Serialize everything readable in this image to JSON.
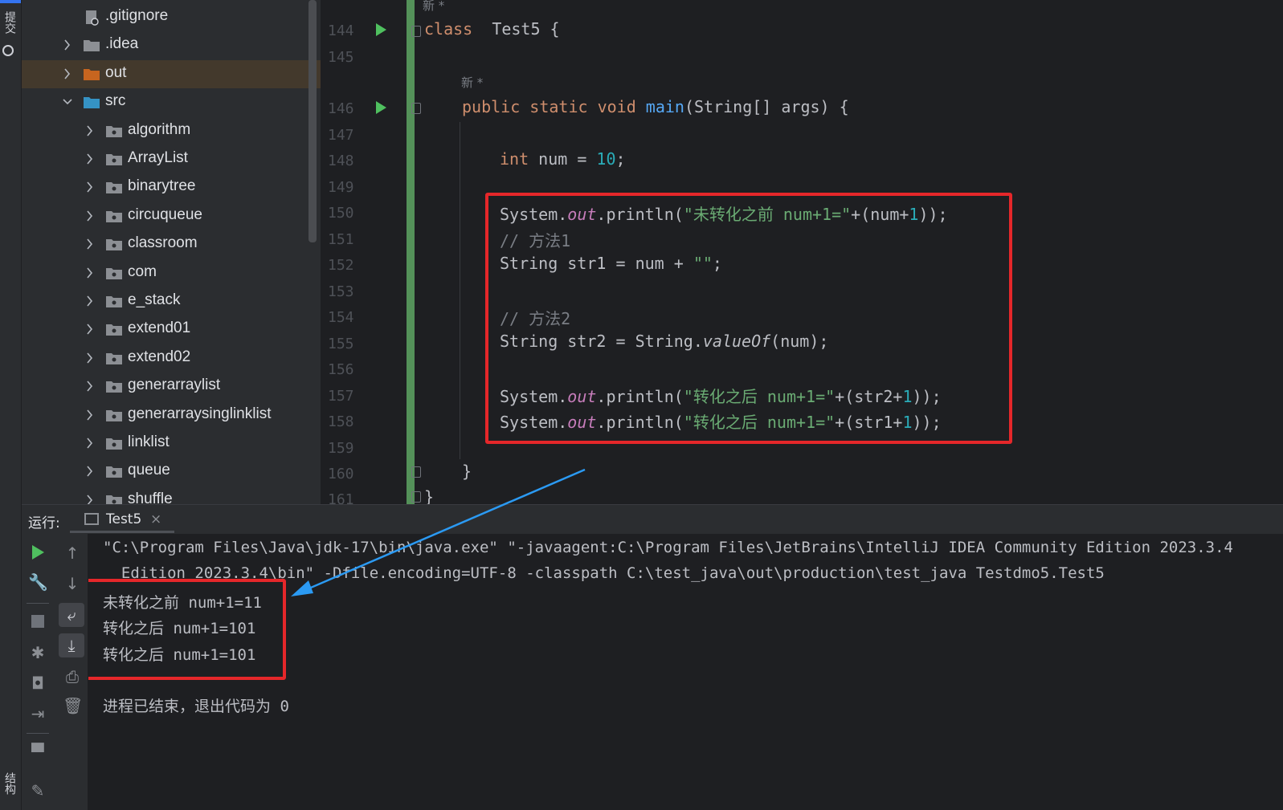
{
  "left_strip": {
    "top_label": "提交",
    "bottom_label": "结构"
  },
  "tree": {
    "items": [
      {
        "label": ".gitignore",
        "kind": "file",
        "depth": 1,
        "expanded": null
      },
      {
        "label": ".idea",
        "kind": "folder",
        "depth": 1,
        "expanded": false
      },
      {
        "label": "out",
        "kind": "folder-orange",
        "depth": 1,
        "expanded": false,
        "selected": true
      },
      {
        "label": "src",
        "kind": "folder-blue",
        "depth": 1,
        "expanded": true
      },
      {
        "label": "algorithm",
        "kind": "package",
        "depth": 2,
        "expanded": false
      },
      {
        "label": "ArrayList",
        "kind": "package",
        "depth": 2,
        "expanded": false
      },
      {
        "label": "binarytree",
        "kind": "package",
        "depth": 2,
        "expanded": false
      },
      {
        "label": "circuqueue",
        "kind": "package",
        "depth": 2,
        "expanded": false
      },
      {
        "label": "classroom",
        "kind": "package",
        "depth": 2,
        "expanded": false
      },
      {
        "label": "com",
        "kind": "package",
        "depth": 2,
        "expanded": false
      },
      {
        "label": "e_stack",
        "kind": "package",
        "depth": 2,
        "expanded": false
      },
      {
        "label": "extend01",
        "kind": "package",
        "depth": 2,
        "expanded": false
      },
      {
        "label": "extend02",
        "kind": "package",
        "depth": 2,
        "expanded": false
      },
      {
        "label": "generarraylist",
        "kind": "package",
        "depth": 2,
        "expanded": false
      },
      {
        "label": "generarraysinglinklist",
        "kind": "package",
        "depth": 2,
        "expanded": false
      },
      {
        "label": "linklist",
        "kind": "package",
        "depth": 2,
        "expanded": false
      },
      {
        "label": "queue",
        "kind": "package",
        "depth": 2,
        "expanded": false
      },
      {
        "label": "shuffle",
        "kind": "package",
        "depth": 2,
        "expanded": false
      }
    ]
  },
  "editor": {
    "hint_new": "新 *",
    "line_numbers": [
      "144",
      "145",
      "146",
      "147",
      "148",
      "149",
      "150",
      "151",
      "152",
      "153",
      "154",
      "155",
      "156",
      "157",
      "158",
      "159",
      "160",
      "161"
    ],
    "lines": {
      "l144": {
        "kw": "class",
        "name": "Test5 {"
      },
      "l146": {
        "kw": "public static void",
        "fn": "main",
        "rest": "(String[] args) {"
      },
      "l148": {
        "kw": "int",
        "mid": " num = ",
        "num": "10",
        "end": ";"
      },
      "l150": {
        "a": "System.",
        "field": "out",
        "b": ".println(",
        "str": "\"未转化之前 num+1=\"",
        "c": "+(num+",
        "num": "1",
        "d": "));"
      },
      "l151": {
        "cmt": "// 方法1"
      },
      "l152": {
        "a": "String str1 = num + ",
        "str": "\"\"",
        "b": ";"
      },
      "l154": {
        "cmt": "// 方法2"
      },
      "l155": {
        "a": "String str2 = String.",
        "ital": "valueOf",
        "b": "(num);"
      },
      "l157": {
        "a": "System.",
        "field": "out",
        "b": ".println(",
        "str": "\"转化之后 num+1=\"",
        "c": "+(str2+",
        "num": "1",
        "d": "));"
      },
      "l158": {
        "a": "System.",
        "field": "out",
        "b": ".println(",
        "str": "\"转化之后 num+1=\"",
        "c": "+(str1+",
        "num": "1",
        "d": "));"
      },
      "l160": {
        "a": "}"
      },
      "l161": {
        "a": "}"
      }
    }
  },
  "run_panel": {
    "label": "运行:",
    "tab": "Test5",
    "tab_close": "×",
    "console": {
      "cmd1": "\"C:\\Program Files\\Java\\jdk-17\\bin\\java.exe\" \"-javaagent:C:\\Program Files\\JetBrains\\IntelliJ IDEA Community Edition 2023.3.4",
      "cmd2": "  Edition 2023.3.4\\bin\" -Dfile.encoding=UTF-8 -classpath C:\\test_java\\out\\production\\test_java Testdmo5.Test5",
      "out1": "未转化之前 num+1=11",
      "out2": "转化之后 num+1=101",
      "out3": "转化之后 num+1=101",
      "exit": "进程已结束，退出代码为 0"
    }
  },
  "colors": {
    "highlight": "#e5272a",
    "arrow": "#2b9af3",
    "run_green": "#4fc05f",
    "change_bar": "#549159"
  },
  "icons": [
    "file-icon",
    "folder-icon",
    "package-icon",
    "run-icon",
    "wrench-icon",
    "stop-icon",
    "camera-icon",
    "print-icon",
    "trash-icon",
    "soft-wrap-icon",
    "scroll-end-icon",
    "up-icon",
    "down-icon"
  ]
}
